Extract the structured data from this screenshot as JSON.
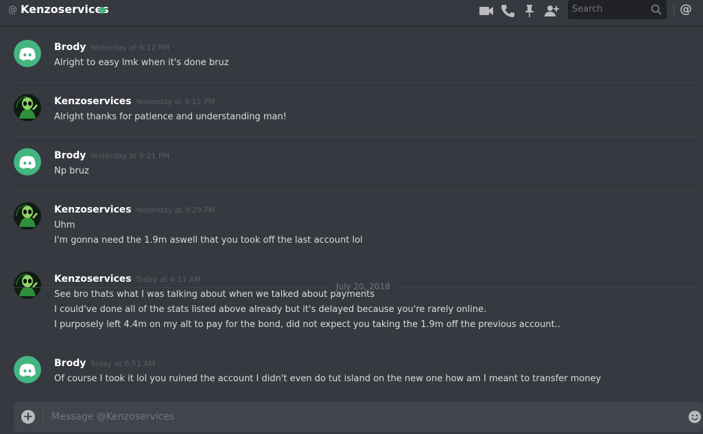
{
  "header": {
    "at_symbol": "@",
    "channel_name": "Kenzoservices",
    "status_color": "#43b581",
    "icons": [
      "video-call-icon",
      "phone-call-icon",
      "pin-icon",
      "add-friend-icon"
    ],
    "search_placeholder": "Search",
    "mention": "@"
  },
  "messages": [
    {
      "author": "Brody",
      "timestamp": "Yesterday at 9:12 PM",
      "avatar": "discord-logo-avatar",
      "lines": [
        "Alright to easy lmk when it's done bruz"
      ]
    },
    {
      "author": "Kenzoservices",
      "timestamp": "Yesterday at 9:12 PM",
      "avatar": "alien-avatar",
      "lines": [
        "Alright thanks for patience and understanding man!"
      ]
    },
    {
      "author": "Brody",
      "timestamp": "Yesterday at 9:21 PM",
      "avatar": "discord-logo-avatar",
      "lines": [
        "Np bruz"
      ]
    },
    {
      "author": "Kenzoservices",
      "timestamp": "Yesterday at 9:29 PM",
      "avatar": "alien-avatar",
      "lines": [
        "Uhm",
        "I'm gonna need the 1.9m aswell that you took off the last account lol"
      ]
    },
    {
      "author": "Kenzoservices",
      "timestamp": "Today at 4:11 AM",
      "avatar": "alien-avatar",
      "lines": [
        "See bro thats what I was talking about when we talked about payments",
        "I could've done all of the stats listed above already but it's delayed because you're rarely online.",
        "I purposely left 4.4m on my alt to pay for the bond, did not expect you taking the 1.9m off the previous account.."
      ]
    },
    {
      "author": "Brody",
      "timestamp": "Today at 6:51 AM",
      "avatar": "discord-logo-avatar",
      "lines": [
        "Of course I took it lol you ruined the account I didn't even do tut island on the new one how am I meant to transfer money"
      ]
    }
  ],
  "date_divider": "July 20, 2018",
  "composer": {
    "placeholder": "Message @Kenzoservices"
  },
  "colors": {
    "background": "#36393f",
    "discord_avatar_bg": "#43b581",
    "alien_avatar_bg": "#0f1a10"
  }
}
